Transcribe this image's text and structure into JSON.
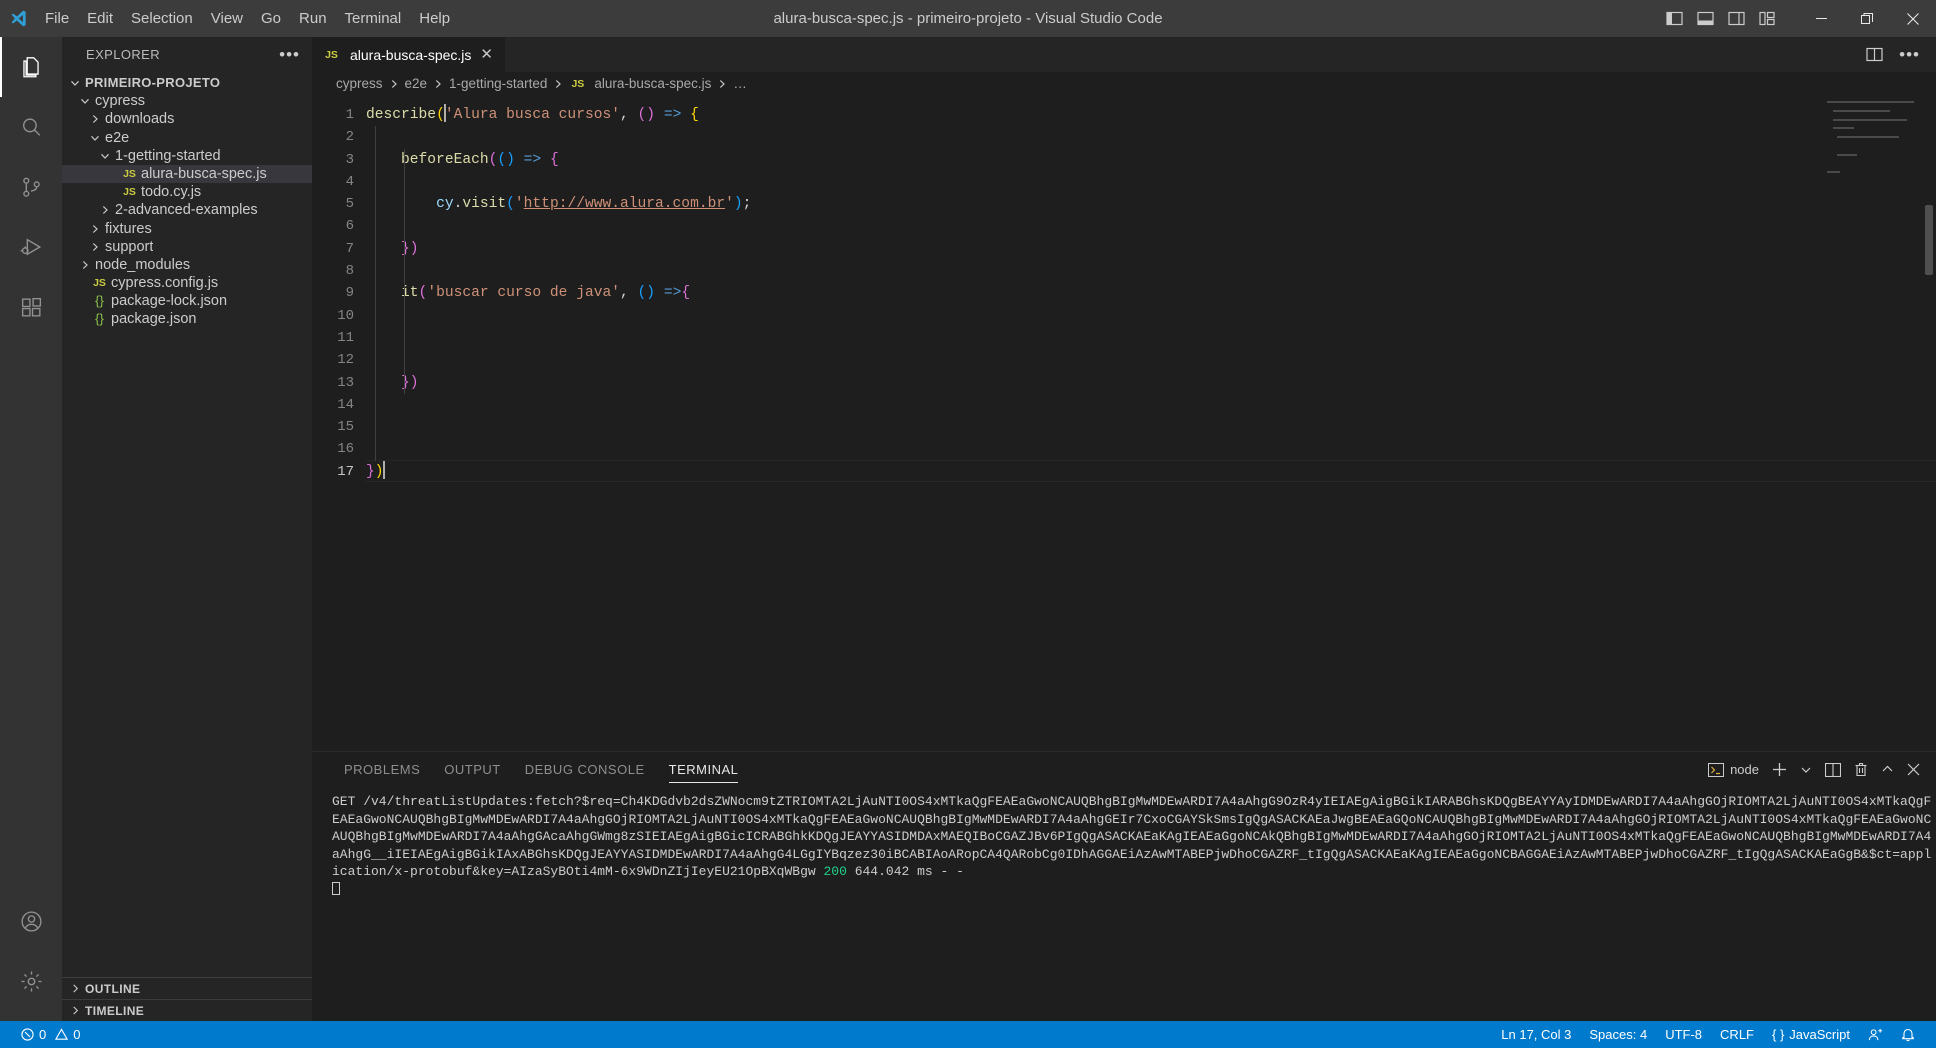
{
  "window": {
    "title": "alura-busca-spec.js - primeiro-projeto - Visual Studio Code",
    "minimize_label": "─",
    "maximize_label": "❐",
    "close_label": "✕"
  },
  "menubar": {
    "items": [
      {
        "label": "File"
      },
      {
        "label": "Edit"
      },
      {
        "label": "Selection"
      },
      {
        "label": "View"
      },
      {
        "label": "Go"
      },
      {
        "label": "Run"
      },
      {
        "label": "Terminal"
      },
      {
        "label": "Help"
      }
    ]
  },
  "activitybar": {
    "items": [
      {
        "name": "explorer-icon",
        "active": true
      },
      {
        "name": "search-icon",
        "active": false
      },
      {
        "name": "source-control-icon",
        "active": false
      },
      {
        "name": "run-and-debug-icon",
        "active": false
      },
      {
        "name": "extensions-icon",
        "active": false
      }
    ],
    "bottom": [
      {
        "name": "accounts-icon"
      },
      {
        "name": "settings-gear-icon"
      }
    ]
  },
  "sidebar": {
    "title": "EXPLORER",
    "more_actions": "•••",
    "tree": [
      {
        "label": "PRIMEIRO-PROJETO",
        "depth": 0,
        "type": "root",
        "expanded": true
      },
      {
        "label": "cypress",
        "depth": 1,
        "type": "folder",
        "expanded": true
      },
      {
        "label": "downloads",
        "depth": 2,
        "type": "folder",
        "expanded": false
      },
      {
        "label": "e2e",
        "depth": 2,
        "type": "folder",
        "expanded": true
      },
      {
        "label": "1-getting-started",
        "depth": 3,
        "type": "folder",
        "expanded": true
      },
      {
        "label": "alura-busca-spec.js",
        "depth": 4,
        "type": "js",
        "selected": true
      },
      {
        "label": "todo.cy.js",
        "depth": 4,
        "type": "js"
      },
      {
        "label": "2-advanced-examples",
        "depth": 3,
        "type": "folder",
        "expanded": false
      },
      {
        "label": "fixtures",
        "depth": 2,
        "type": "folder",
        "expanded": false
      },
      {
        "label": "support",
        "depth": 2,
        "type": "folder",
        "expanded": false
      },
      {
        "label": "node_modules",
        "depth": 1,
        "type": "folder",
        "expanded": false
      },
      {
        "label": "cypress.config.js",
        "depth": 1,
        "type": "js"
      },
      {
        "label": "package-lock.json",
        "depth": 1,
        "type": "json"
      },
      {
        "label": "package.json",
        "depth": 1,
        "type": "json"
      }
    ],
    "sections": [
      {
        "label": "OUTLINE"
      },
      {
        "label": "TIMELINE"
      }
    ]
  },
  "editor": {
    "tabs": [
      {
        "label": "alura-busca-spec.js",
        "icon": "js",
        "active": true,
        "close": "✕"
      }
    ],
    "breadcrumbs": [
      "cypress",
      "e2e",
      "1-getting-started",
      "alura-busca-spec.js",
      "…"
    ],
    "line_count": 17,
    "current_line": 17,
    "code_lines": [
      {
        "n": 1,
        "tokens": [
          {
            "t": "describe",
            "c": "fn"
          },
          {
            "t": "(",
            "c": "p1"
          },
          {
            "t": "cursor",
            "c": "cursor"
          },
          {
            "t": "'Alura busca cursos'",
            "c": "str"
          },
          {
            "t": ",",
            "c": "plain"
          },
          {
            "t": " ",
            "c": "plain"
          },
          {
            "t": "(",
            "c": "p2"
          },
          {
            "t": ")",
            "c": "p2"
          },
          {
            "t": " ",
            "c": "plain"
          },
          {
            "t": "=>",
            "c": "kw"
          },
          {
            "t": " ",
            "c": "plain"
          },
          {
            "t": "{",
            "c": "p1"
          }
        ]
      },
      {
        "n": 2,
        "tokens": []
      },
      {
        "n": 3,
        "tokens": [
          {
            "t": "    ",
            "c": "plain"
          },
          {
            "t": "beforeEach",
            "c": "fn"
          },
          {
            "t": "(",
            "c": "p2"
          },
          {
            "t": "(",
            "c": "p3"
          },
          {
            "t": ")",
            "c": "p3"
          },
          {
            "t": " ",
            "c": "plain"
          },
          {
            "t": "=>",
            "c": "kw"
          },
          {
            "t": " ",
            "c": "plain"
          },
          {
            "t": "{",
            "c": "p2"
          }
        ]
      },
      {
        "n": 4,
        "tokens": []
      },
      {
        "n": 5,
        "tokens": [
          {
            "t": "        ",
            "c": "plain"
          },
          {
            "t": "cy",
            "c": "var"
          },
          {
            "t": ".",
            "c": "plain"
          },
          {
            "t": "visit",
            "c": "fn"
          },
          {
            "t": "(",
            "c": "p3"
          },
          {
            "t": "'",
            "c": "str"
          },
          {
            "t": "http://www.alura.com.br",
            "c": "link"
          },
          {
            "t": "'",
            "c": "str"
          },
          {
            "t": ")",
            "c": "p3"
          },
          {
            "t": ";",
            "c": "plain"
          }
        ]
      },
      {
        "n": 6,
        "tokens": []
      },
      {
        "n": 7,
        "tokens": [
          {
            "t": "    ",
            "c": "plain"
          },
          {
            "t": "}",
            "c": "p2"
          },
          {
            "t": ")",
            "c": "p2"
          }
        ]
      },
      {
        "n": 8,
        "tokens": []
      },
      {
        "n": 9,
        "tokens": [
          {
            "t": "    ",
            "c": "plain"
          },
          {
            "t": "it",
            "c": "fn"
          },
          {
            "t": "(",
            "c": "p2"
          },
          {
            "t": "'buscar curso de java'",
            "c": "str"
          },
          {
            "t": ",",
            "c": "plain"
          },
          {
            "t": " ",
            "c": "plain"
          },
          {
            "t": "(",
            "c": "p3"
          },
          {
            "t": ")",
            "c": "p3"
          },
          {
            "t": " ",
            "c": "plain"
          },
          {
            "t": "=>",
            "c": "kw"
          },
          {
            "t": "{",
            "c": "p2"
          }
        ]
      },
      {
        "n": 10,
        "tokens": []
      },
      {
        "n": 11,
        "tokens": []
      },
      {
        "n": 12,
        "tokens": []
      },
      {
        "n": 13,
        "tokens": [
          {
            "t": "    ",
            "c": "plain"
          },
          {
            "t": "}",
            "c": "p2"
          },
          {
            "t": ")",
            "c": "p2"
          }
        ]
      },
      {
        "n": 14,
        "tokens": []
      },
      {
        "n": 15,
        "tokens": []
      },
      {
        "n": 16,
        "tokens": []
      },
      {
        "n": 17,
        "tokens": [
          {
            "t": "}",
            "c": "p2"
          },
          {
            "t": ")",
            "c": "p1"
          },
          {
            "t": "cursor",
            "c": "cursor"
          }
        ]
      }
    ]
  },
  "panel": {
    "tabs": [
      {
        "label": "PROBLEMS",
        "active": false
      },
      {
        "label": "OUTPUT",
        "active": false
      },
      {
        "label": "DEBUG CONSOLE",
        "active": false
      },
      {
        "label": "TERMINAL",
        "active": true
      }
    ],
    "terminal_name": "node",
    "actions": [
      {
        "name": "new-terminal-icon",
        "glyph": "+"
      },
      {
        "name": "terminal-dropdown-icon",
        "glyph": "⌄"
      },
      {
        "name": "split-terminal-icon",
        "glyph": "split"
      },
      {
        "name": "kill-terminal-icon",
        "glyph": "trash"
      },
      {
        "name": "maximize-panel-icon",
        "glyph": "⌃"
      },
      {
        "name": "close-panel-icon",
        "glyph": "✕"
      }
    ],
    "terminal_output_pre": "GET /v4/threatListUpdates:fetch?$req=Ch4KDGdvb2dsZWNocm9tZTRIOMTA2LjAuNTI0OS4xMTkaQgFEAEaGwoNCAUQBhgBIgMwMDEwARDI7A4aAhgG9OzR4yIEIAEgAigBGikIARABGhsKDQgBEAYYAyIDMDEwARDI7A4aAhgGOjRIOMTA2LjAuNTI0OS4xMTkaQgFEAEaGwoNCAUQBhgBIgMwMDEwARDI7A4aAhgGOjRIOMTA2LjAuNTI0OS4xMTkaQgFEAEaGwoNCAUQBhgBIgMwMDEwARDI7A4aAhgGEIr7CxoCGAYSkSmsIgQgASACKAEaJwgBEAEaGQoNCAUQBhgBIgMwMDEwARDI7A4aAhgGOjRIOMTA2LjAuNTI0OS4xMTkaQgFEAEaGwoNCAUQBhgBIgMwMDEwARDI7A4aAhgGAcaAhgGWmg8zSIEIAEgAigBGicICRABGhkKDQgJEAYYASIDMDAxMAEQIBoCGAZJBv6PIgQgASACKAEaKAgIEAEaGgoNCAkQBhgBIgMwMDEwARDI7A4aAhgGOjRIOMTA2LjAuNTI0OS4xMTkaQgFEAEaGwoNCAUQBhgBIgMwMDEwARDI7A4aAhgG__iIEIAEgAigBGikIAxABGhsKDQgJEAYYASIDMDEwARDI7A4aAhgG4LGgIYBqzez30iBCABIAoARopCA4QARobCg0IDhAGGAEiAzAwMTABEPjwDhoCGAZRF_tIgQgASACKAEaKAgIEAEaGgoNCBAGGAEiAzAwMTABEPjwDhoCGAZRF_tIgQgASACKAEaGgB&$ct=application/x-protobuf&key=AIzaSyBOti4mM-6x9WDnZIjIeyEU21OpBXqWBgw ",
    "terminal_status_code": "200",
    "terminal_timing": " 644.042 ms - -"
  },
  "statusbar": {
    "problems_errors": "0",
    "problems_warnings": "0",
    "cursor_position": "Ln 17, Col 3",
    "indentation": "Spaces: 4",
    "encoding": "UTF-8",
    "eol": "CRLF",
    "language": "JavaScript",
    "remote_icon": "remote-window-icon",
    "bell_icon": "notifications-bell-icon"
  },
  "colors": {
    "accent": "#007acc",
    "titlebar_bg": "#3c3c3c",
    "sidebar_bg": "#252526",
    "editor_bg": "#1e1e1e",
    "activitybar_bg": "#333333",
    "status_ok": "#23d18b",
    "selection_bg": "#37373d"
  }
}
